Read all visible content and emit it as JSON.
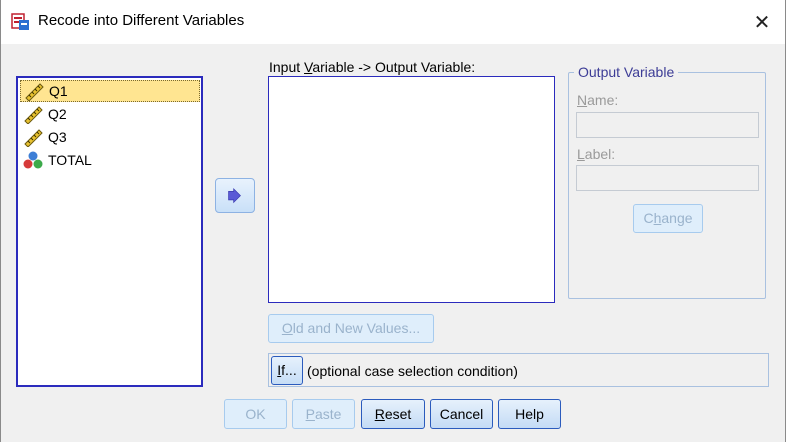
{
  "window": {
    "title": "Recode into Different Variables",
    "close_glyph": "✕"
  },
  "source_list": {
    "items": [
      {
        "label": "Q1",
        "icon": "ruler-scale-icon",
        "selected": true
      },
      {
        "label": "Q2",
        "icon": "ruler-scale-icon",
        "selected": false
      },
      {
        "label": "Q3",
        "icon": "ruler-scale-icon",
        "selected": false
      },
      {
        "label": "TOTAL",
        "icon": "nominal-balls-icon",
        "selected": false
      }
    ]
  },
  "move_button": {
    "icon": "arrow-right-icon"
  },
  "io_section": {
    "label_pre": "Input ",
    "label_mnemonic": "V",
    "label_post": "ariable -> Output Variable:"
  },
  "output_variable": {
    "group_title": "Output Variable",
    "name_mnemonic": "N",
    "name_rest": "ame:",
    "name_value": "",
    "label_mnemonic": "L",
    "label_rest": "abel:",
    "label_value": "",
    "change_pre": "C",
    "change_mnemonic": "h",
    "change_post": "ange"
  },
  "old_new_button": {
    "mnemonic": "O",
    "rest": "ld and New Values..."
  },
  "if_section": {
    "button_mnemonic": "I",
    "button_rest": "f...",
    "description": "(optional case selection condition)"
  },
  "buttons": {
    "ok": "OK",
    "paste_mnemonic": "P",
    "paste_rest": "aste",
    "reset_mnemonic": "R",
    "reset_rest": "eset",
    "cancel": "Cancel",
    "help": "Help"
  },
  "colors": {
    "list_border": "#2b2bbd",
    "selection": "#ffe591",
    "disabled_text": "#9ab3cc",
    "group_title": "#3c3c96"
  }
}
